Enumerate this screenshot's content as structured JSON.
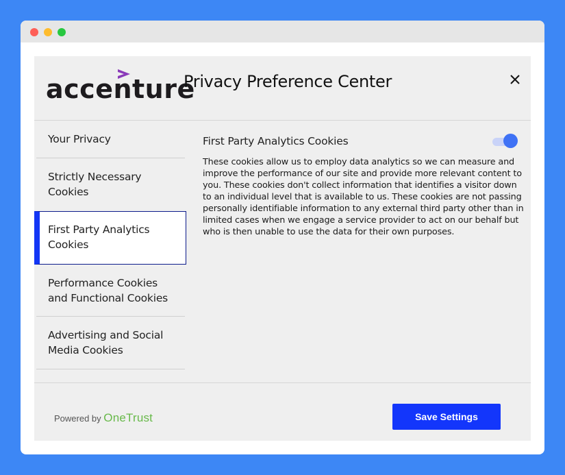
{
  "window": {
    "controls": [
      "close",
      "minimize",
      "maximize"
    ]
  },
  "header": {
    "logo_text": "accenture",
    "title": "Privacy Preference Center",
    "close_icon": "close-icon"
  },
  "sidebar": {
    "items": [
      {
        "label": "Your Privacy",
        "selected": false
      },
      {
        "label": "Strictly Necessary Cookies",
        "selected": false
      },
      {
        "label": "First Party Analytics Cookies",
        "selected": true
      },
      {
        "label": "Performance Cookies and Functional Cookies",
        "selected": false
      },
      {
        "label": "Advertising and Social Media Cookies",
        "selected": false
      }
    ]
  },
  "content": {
    "title": "First Party Analytics Cookies",
    "toggle_on": true,
    "description": "These cookies allow us to employ data analytics so we can measure and improve the performance of our site and provide more relevant content to you. These cookies don't collect information that identifies a visitor down to an individual level that is available to us. These cookies are not passing personally identifiable information to any external third party other than in limited cases when we engage a service provider to act on our behalf but who is then unable to use the data for their own purposes."
  },
  "footer": {
    "powered_by": "Powered by",
    "brand": "OneTrust",
    "save_label": "Save Settings"
  },
  "colors": {
    "background": "#3d87f5",
    "accent": "#1336fb",
    "logo_chevron": "#a100ff",
    "onetrust_green": "#68b94a"
  }
}
